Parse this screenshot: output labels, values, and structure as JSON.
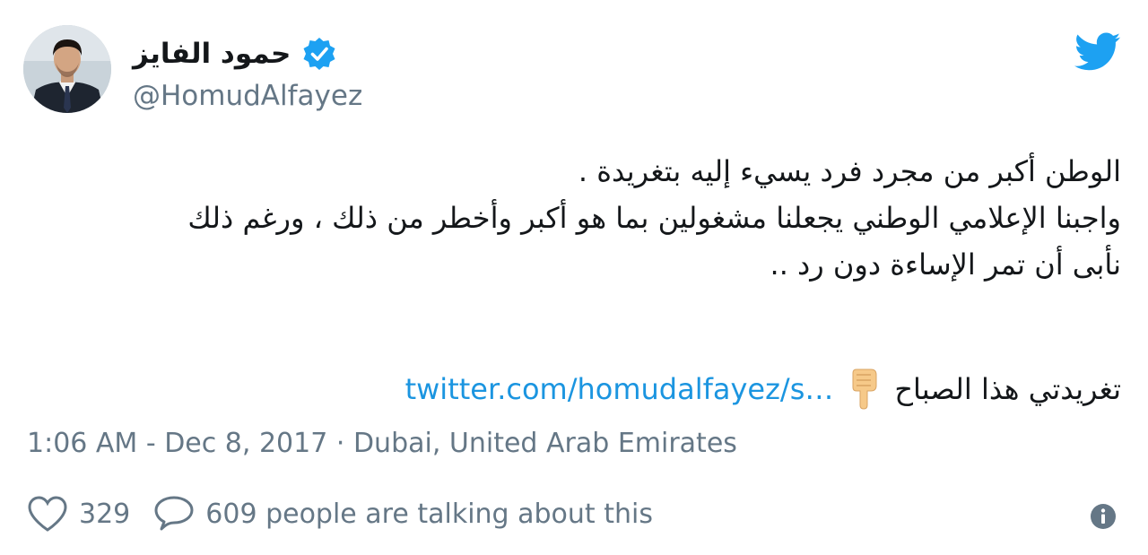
{
  "author": {
    "display_name": "حمود الفايز",
    "handle": "@HomudAlfayez",
    "verified": true
  },
  "tweet": {
    "lines": [
      "الوطن أكبر من مجرد فرد يسيء إليه بتغريدة .",
      "واجبنا الإعلامي الوطني يجعلنا مشغولين بما هو أكبر وأخطر من ذلك ، ورغم ذلك",
      "نأبى أن تمر الإساءة دون رد .."
    ],
    "link_label": "تغريدتي هذا الصباح",
    "link_text": "twitter.com/homudalfayez/s…",
    "timestamp": "1:06 AM - Dec 8, 2017",
    "separator": "·",
    "location": "Dubai, United Arab Emirates"
  },
  "actions": {
    "likes": "329",
    "replies_text": "609 people are talking about this"
  },
  "icons": {
    "verified": "verified-badge-icon",
    "twitter": "twitter-bird-icon",
    "hand": "pointing-down-hand-icon",
    "heart": "heart-icon",
    "reply": "reply-bubble-icon",
    "info": "info-icon"
  },
  "colors": {
    "accent": "#1da1f2",
    "link": "#1b95e0",
    "muted": "#657786",
    "text": "#14171a"
  }
}
